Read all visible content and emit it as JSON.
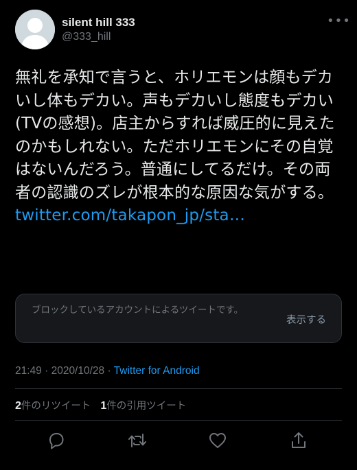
{
  "author": {
    "display_name": "silent hill 333",
    "handle": "@333_hill"
  },
  "tweet": {
    "text": "無礼を承知で言うと、ホリエモンは顔もデカいし体もデカい。声もデカいし態度もデカい (TVの感想)。店主からすれば威圧的に見えたのかもしれない。ただホリエモンにその自覚はないんだろう。普通にしてるだけ。その両者の認識のズレが根本的な原因な気がする。",
    "link": "twitter.com/takapon_jp/sta…"
  },
  "quoted_tweet": {
    "notice": "ブロックしているアカウントによるツイートです。",
    "show_button": "表示する"
  },
  "meta": {
    "time": "21:49",
    "separator1": " · ",
    "date": "2020/10/28",
    "separator2": " · ",
    "client": "Twitter for Android"
  },
  "stats": {
    "retweets_count": "2",
    "retweets_label": "件のリツイート",
    "quotes_count": "1",
    "quotes_label": "件の引用ツイート"
  },
  "icons": {
    "more": "more-icon",
    "reply": "reply-icon",
    "retweet": "retweet-icon",
    "like": "like-icon",
    "share": "share-icon"
  },
  "colors": {
    "background": "#000000",
    "text": "#e7e9ea",
    "secondary": "#71767b",
    "link": "#1d9bf0",
    "card": "#16181c",
    "border": "#2f3336"
  }
}
